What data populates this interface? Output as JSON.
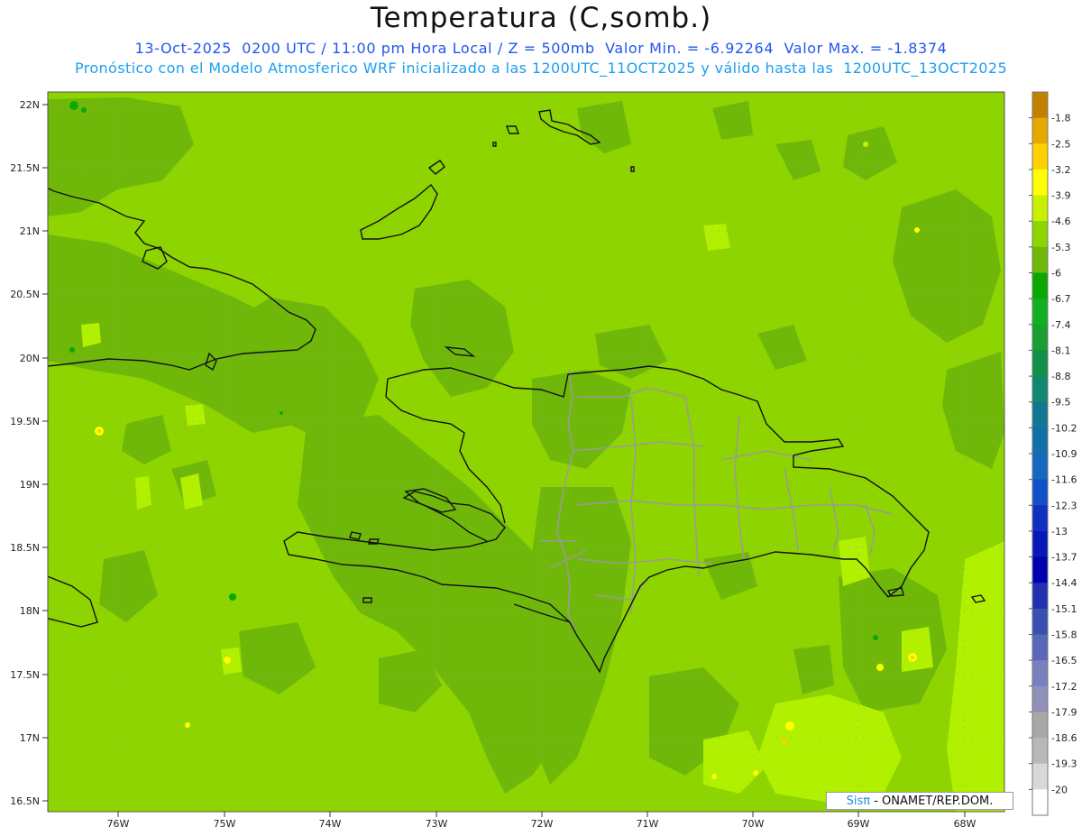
{
  "header": {
    "title": "Temperatura (C,somb.)",
    "subtitle1": "13-Oct-2025  0200 UTC / 11:00 pm Hora Local / Z = 500mb  Valor Min. = -6.92264  Valor Max. = -1.8374",
    "subtitle2": "Pronóstico con el Modelo Atmosferico WRF inicializado a las 1200UTC_11OCT2025 y válido hasta las  1200UTC_13OCT2025"
  },
  "map": {
    "lat_labels": [
      "22N",
      "21.5N",
      "21N",
      "20.5N",
      "20N",
      "19.5N",
      "19N",
      "18.5N",
      "18N",
      "17.5N",
      "17N",
      "16.5N"
    ],
    "lon_labels": [
      "76W",
      "75W",
      "74W",
      "73W",
      "72W",
      "71W",
      "70W",
      "69W",
      "68W"
    ],
    "background_color": "#8dd400",
    "dark_shade_color": "#6fb80a",
    "light_shade_color": "#b0f000"
  },
  "colorbar": {
    "levels": [
      "-1.8",
      "-2.5",
      "-3.2",
      "-3.9",
      "-4.6",
      "-5.3",
      "-6",
      "-6.7",
      "-7.4",
      "-8.1",
      "-8.8",
      "-9.5",
      "-10.2",
      "-10.9",
      "-11.6",
      "-12.3",
      "-13",
      "-13.7",
      "-14.4",
      "-15.1",
      "-15.8",
      "-16.5",
      "-17.2",
      "-17.9",
      "-18.6",
      "-19.3",
      "-20"
    ],
    "colors": [
      "#c08000",
      "#e6a800",
      "#ffd000",
      "#ffff00",
      "#c8f000",
      "#8dd400",
      "#6fb80a",
      "#0aa800",
      "#10b020",
      "#18a030",
      "#10904a",
      "#108870",
      "#107890",
      "#1070a8",
      "#1468c0",
      "#1050c8",
      "#1030c0",
      "#0818b8",
      "#0000b0",
      "#2030b0",
      "#3850b0",
      "#5868b8",
      "#7880c0",
      "#9090b8",
      "#a8a8a8",
      "#b8b8b8",
      "#d8d8d8",
      "#ffffff"
    ]
  },
  "credit": {
    "sis": "Sisπ",
    "text": " - ONAMET/REP.DOM."
  }
}
